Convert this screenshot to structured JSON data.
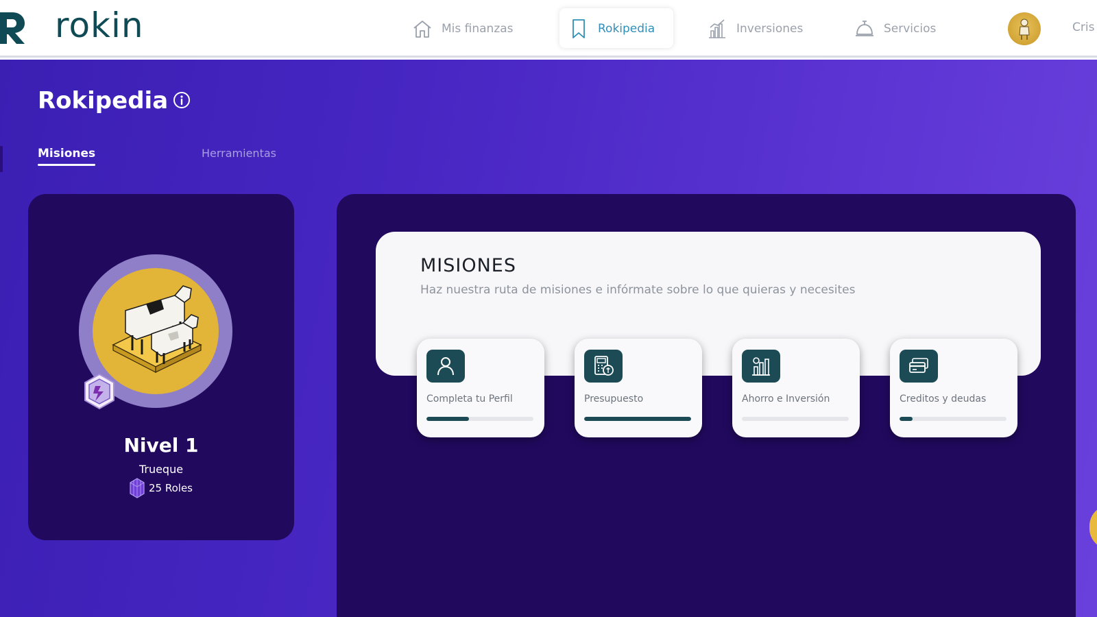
{
  "app": {
    "logo_text": "rokin"
  },
  "nav": {
    "items": [
      {
        "label": "Mis finanzas",
        "icon": "home-icon",
        "active": false
      },
      {
        "label": "Rokipedia",
        "icon": "bookmark-icon",
        "active": true
      },
      {
        "label": "Inversiones",
        "icon": "chart-building-icon",
        "active": false
      },
      {
        "label": "Servicios",
        "icon": "service-bell-icon",
        "active": false
      }
    ],
    "user_name": "Cris"
  },
  "page": {
    "title": "Rokipedia",
    "tabs": [
      {
        "label": "Misiones",
        "active": true
      },
      {
        "label": "Herramientas",
        "active": false
      }
    ]
  },
  "level": {
    "title": "Nivel 1",
    "subtitle": "Trueque",
    "roles": "25 Roles"
  },
  "missions": {
    "title": "MISIONES",
    "description": "Haz nuestra ruta de misiones e infórmate sobre lo que quieras y necesites",
    "items": [
      {
        "label": "Completa tu Perfil",
        "icon": "user-icon",
        "progress": 0.4
      },
      {
        "label": "Presupuesto",
        "icon": "calculator-icon",
        "progress": 1.0
      },
      {
        "label": "Ahorro e Inversión",
        "icon": "savings-chart-icon",
        "progress": 0.0
      },
      {
        "label": "Creditos y deudas",
        "icon": "credit-card-icon",
        "progress": 0.12
      }
    ]
  },
  "colors": {
    "brand_teal": "#1c4b55",
    "active_nav": "#2f8fb8",
    "background_purple": "#4726c2",
    "panel_dark": "#21095e",
    "medal_gold": "#e2b437"
  }
}
